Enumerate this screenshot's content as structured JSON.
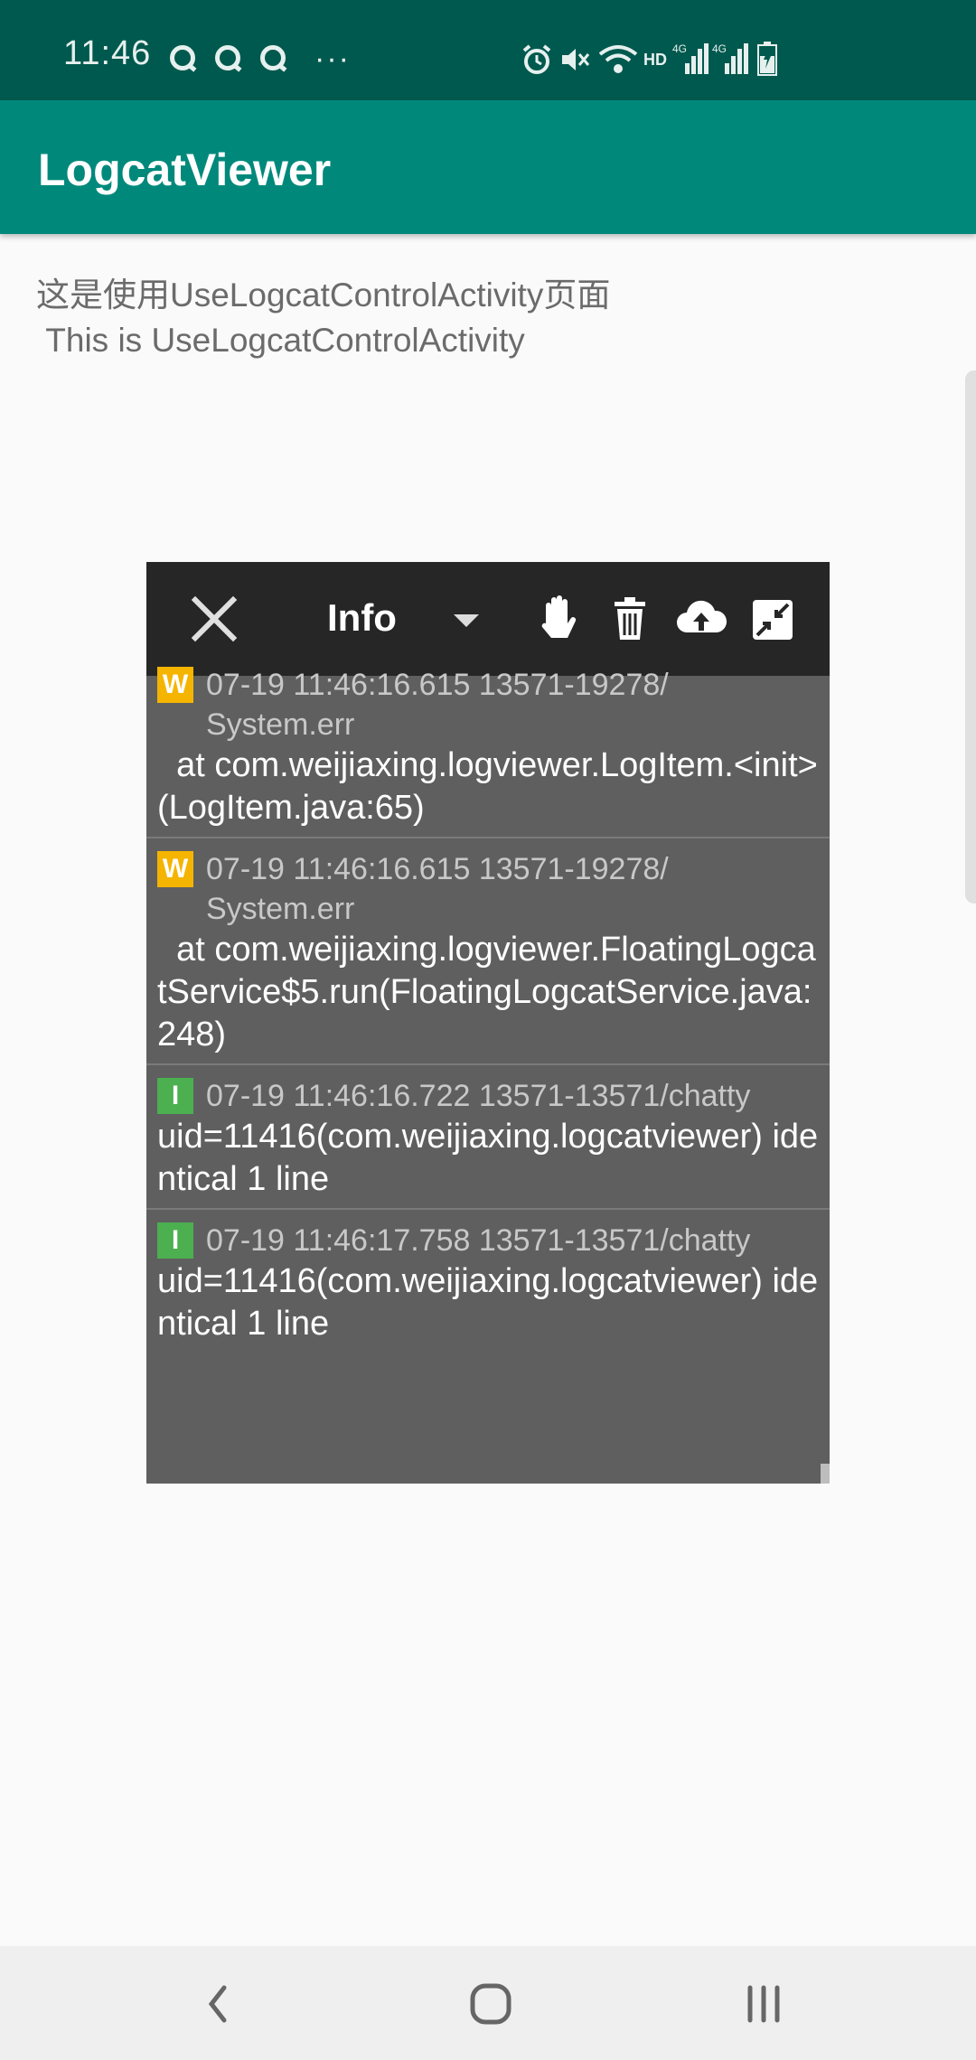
{
  "status_bar": {
    "time": "11:46",
    "more": "···"
  },
  "app_bar": {
    "title": "LogcatViewer"
  },
  "content": {
    "description": "这是使用UseLogcatControlActivity页面\n This is UseLogcatControlActivity"
  },
  "log_window": {
    "level": "Info",
    "entries": [
      {
        "level": "W",
        "meta": "07-19 11:46:16.615 13571-19278/ System.err",
        "message": "  at com.weijiaxing.logviewer.LogItem.<init>(LogItem.java:65)"
      },
      {
        "level": "W",
        "meta": "07-19 11:46:16.615 13571-19278/ System.err",
        "message": "  at com.weijiaxing.logviewer.FloatingLogcatService$5.run(FloatingLogcatService.java:248)"
      },
      {
        "level": "I",
        "meta": "07-19 11:46:16.722 13571-13571/chatty",
        "message": "uid=11416(com.weijiaxing.logcatviewer) identical 1 line"
      },
      {
        "level": "I",
        "meta": "07-19 11:46:17.758 13571-13571/chatty",
        "message": "uid=11416(com.weijiaxing.logcatviewer) identical 1 line"
      }
    ]
  },
  "colors": {
    "status_bar": "#00594e",
    "app_bar": "#00897b",
    "warn_badge": "#f4b400",
    "info_badge": "#4caf50"
  }
}
